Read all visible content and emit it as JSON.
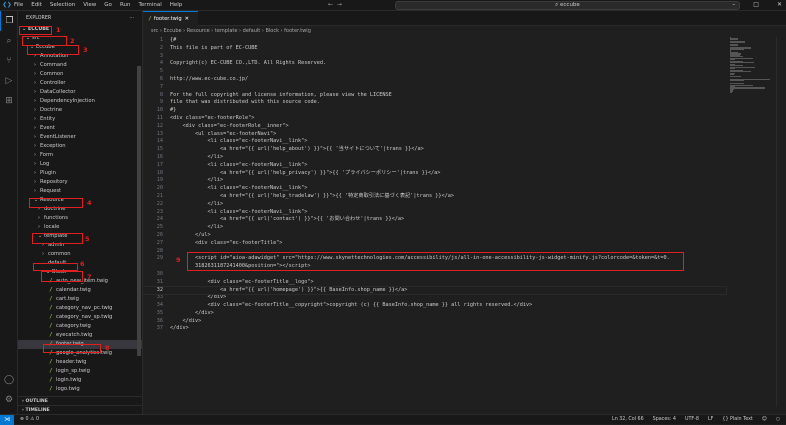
{
  "titlebar": {
    "menu": [
      "File",
      "Edit",
      "Selection",
      "View",
      "Go",
      "Run",
      "Terminal",
      "Help"
    ],
    "search": "eccube"
  },
  "sidebar": {
    "title": "EXPLORER",
    "more": "···",
    "items": [
      {
        "label": "ECCUBE",
        "depth": 0,
        "type": "folder",
        "open": true,
        "bold": true
      },
      {
        "label": "src",
        "depth": 1,
        "type": "folder",
        "open": true
      },
      {
        "label": "Eccube",
        "depth": 2,
        "type": "folder",
        "open": true
      },
      {
        "label": "Annotation",
        "depth": 3,
        "type": "folder"
      },
      {
        "label": "Command",
        "depth": 3,
        "type": "folder"
      },
      {
        "label": "Common",
        "depth": 3,
        "type": "folder"
      },
      {
        "label": "Controller",
        "depth": 3,
        "type": "folder"
      },
      {
        "label": "DataCollector",
        "depth": 3,
        "type": "folder"
      },
      {
        "label": "DependencyInjection",
        "depth": 3,
        "type": "folder"
      },
      {
        "label": "Doctrine",
        "depth": 3,
        "type": "folder"
      },
      {
        "label": "Entity",
        "depth": 3,
        "type": "folder"
      },
      {
        "label": "Event",
        "depth": 3,
        "type": "folder"
      },
      {
        "label": "EventListener",
        "depth": 3,
        "type": "folder"
      },
      {
        "label": "Exception",
        "depth": 3,
        "type": "folder"
      },
      {
        "label": "Form",
        "depth": 3,
        "type": "folder"
      },
      {
        "label": "Log",
        "depth": 3,
        "type": "folder"
      },
      {
        "label": "Plugin",
        "depth": 3,
        "type": "folder"
      },
      {
        "label": "Repository",
        "depth": 3,
        "type": "folder"
      },
      {
        "label": "Request",
        "depth": 3,
        "type": "folder"
      },
      {
        "label": "Resource",
        "depth": 3,
        "type": "folder",
        "open": true
      },
      {
        "label": "doctrine",
        "depth": 4,
        "type": "folder"
      },
      {
        "label": "functions",
        "depth": 4,
        "type": "folder"
      },
      {
        "label": "locale",
        "depth": 4,
        "type": "folder"
      },
      {
        "label": "template",
        "depth": 4,
        "type": "folder",
        "open": true
      },
      {
        "label": "admin",
        "depth": 5,
        "type": "folder"
      },
      {
        "label": "common",
        "depth": 5,
        "type": "folder"
      },
      {
        "label": "default",
        "depth": 5,
        "type": "folder",
        "open": true
      },
      {
        "label": "Block",
        "depth": 6,
        "type": "folder",
        "open": true
      },
      {
        "label": "auto_new_item.twig",
        "depth": 7,
        "type": "file"
      },
      {
        "label": "calendar.twig",
        "depth": 7,
        "type": "file"
      },
      {
        "label": "cart.twig",
        "depth": 7,
        "type": "file"
      },
      {
        "label": "category_nav_pc.twig",
        "depth": 7,
        "type": "file"
      },
      {
        "label": "category_nav_sp.twig",
        "depth": 7,
        "type": "file"
      },
      {
        "label": "category.twig",
        "depth": 7,
        "type": "file"
      },
      {
        "label": "eyecatch.twig",
        "depth": 7,
        "type": "file"
      },
      {
        "label": "footer.twig",
        "depth": 7,
        "type": "file",
        "selected": true
      },
      {
        "label": "google_analytics.twig",
        "depth": 7,
        "type": "file"
      },
      {
        "label": "header.twig",
        "depth": 7,
        "type": "file"
      },
      {
        "label": "login_sp.twig",
        "depth": 7,
        "type": "file"
      },
      {
        "label": "login.twig",
        "depth": 7,
        "type": "file"
      },
      {
        "label": "logo.twig",
        "depth": 7,
        "type": "file"
      }
    ],
    "outline": "OUTLINE",
    "timeline": "TIMELINE"
  },
  "annotations": [
    "1",
    "2",
    "3",
    "4",
    "5",
    "6",
    "7",
    "8",
    "9"
  ],
  "annotation_color": "#e02020",
  "editor": {
    "tab": "footer.twig",
    "breadcrumb": [
      "src",
      "Eccube",
      "Resource",
      "template",
      "default",
      "Block",
      "footer.twig"
    ],
    "lines": [
      {
        "n": "1",
        "t": "{#"
      },
      {
        "n": "2",
        "t": "This file is part of EC-CUBE"
      },
      {
        "n": "3",
        "t": ""
      },
      {
        "n": "4",
        "t": "Copyright(c) EC-CUBE CO.,LTD. All Rights Reserved."
      },
      {
        "n": "5",
        "t": ""
      },
      {
        "n": "6",
        "t": "http://www.ec-cube.co.jp/"
      },
      {
        "n": "7",
        "t": ""
      },
      {
        "n": "8",
        "t": "For the full copyright and license information, please view the LICENSE"
      },
      {
        "n": "9",
        "t": "file that was distributed with this source code."
      },
      {
        "n": "10",
        "t": "#}"
      },
      {
        "n": "11",
        "t": "<div class=\"ec-footerRole\">"
      },
      {
        "n": "12",
        "t": "    <div class=\"ec-footerRole__inner\">"
      },
      {
        "n": "13",
        "t": "        <ul class=\"ec-footerNavi\">"
      },
      {
        "n": "14",
        "t": "            <li class=\"ec-footerNavi__link\">"
      },
      {
        "n": "15",
        "t": "                <a href=\"{{ url('help_about') }}\">{{ '当サイトについて'|trans }}</a>"
      },
      {
        "n": "16",
        "t": "            </li>"
      },
      {
        "n": "17",
        "t": "            <li class=\"ec-footerNavi__link\">"
      },
      {
        "n": "18",
        "t": "                <a href=\"{{ url('help_privacy') }}\">{{ 'プライバシーポリシー'|trans }}</a>"
      },
      {
        "n": "19",
        "t": "            </li>"
      },
      {
        "n": "20",
        "t": "            <li class=\"ec-footerNavi__link\">"
      },
      {
        "n": "21",
        "t": "                <a href=\"{{ url('help_tradelaw') }}\">{{ '特定商取引法に基づく表記'|trans }}</a>"
      },
      {
        "n": "22",
        "t": "            </li>"
      },
      {
        "n": "23",
        "t": "            <li class=\"ec-footerNavi__link\">"
      },
      {
        "n": "24",
        "t": "                <a href=\"{{ url('contact') }}\">{{ 'お問い合わせ'|trans }}</a>"
      },
      {
        "n": "25",
        "t": "            </li>"
      },
      {
        "n": "26",
        "t": "        </ul>"
      },
      {
        "n": "27",
        "t": "        <div class=\"ec-footerTitle\">"
      },
      {
        "n": "28",
        "t": ""
      },
      {
        "n": "29",
        "t": "        <script id=\"aioa-adawidget\" src=\"https://www.skynettechnologies.com/accessibility/js/all-in-one-accessibility-js-widget-minify.js?colorcode=&token=&t=0."
      },
      {
        "n": "",
        "t": "        3182631187241400&position=\"></script>"
      },
      {
        "n": "30",
        "t": ""
      },
      {
        "n": "31",
        "t": "            <div class=\"ec-footerTitle__logo\">"
      },
      {
        "n": "32",
        "t": "                <a href=\"{{ url('homepage') }}\">{{ BaseInfo.shop_name }}</a>"
      },
      {
        "n": "33",
        "t": "            </div>"
      },
      {
        "n": "34",
        "t": "            <div class=\"ec-footerTitle__copyright\">copyright (c) {{ BaseInfo.shop_name }} all rights reserved.</div>"
      },
      {
        "n": "35",
        "t": "        </div>"
      },
      {
        "n": "36",
        "t": "    </div>"
      },
      {
        "n": "37",
        "t": "</div>"
      }
    ]
  },
  "status": {
    "errors": "0",
    "warnings": "0",
    "position": "Ln 32, Col 66",
    "spaces": "Spaces: 4",
    "encoding": "UTF-8",
    "eol": "LF",
    "language": "Plain Text"
  },
  "colors": {
    "accent": "#0078d4",
    "twig_icon": "#8dc149"
  }
}
